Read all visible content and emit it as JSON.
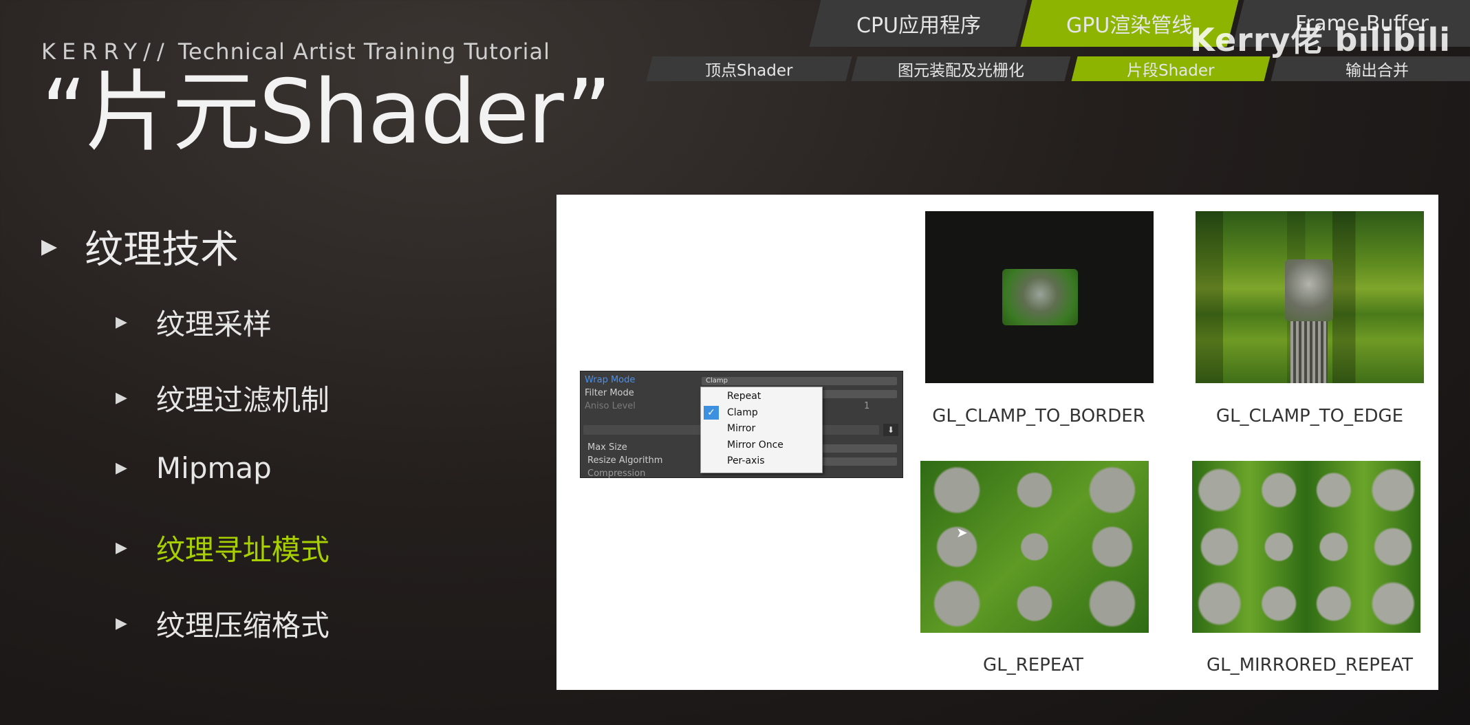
{
  "header": {
    "subtitle_brand": "KERRY//",
    "subtitle_rest": "Technical Artist Training Tutorial",
    "title": "“片元Shader”"
  },
  "top_tabs": [
    "CPU应用程序",
    "GPU渲染管线",
    "Frame Buffer"
  ],
  "sub_tabs": [
    "顶点Shader",
    "图元装配及光栅化",
    "片段Shader",
    "输出合并"
  ],
  "watermark": "Kerry佬 bilibili",
  "bullets": {
    "main": "纹理技术",
    "items": [
      "纹理采样",
      "纹理过滤机制",
      "Mipmap",
      "纹理寻址模式",
      "纹理压缩格式"
    ]
  },
  "inspector": {
    "rows": [
      "Wrap Mode",
      "Filter Mode",
      "Aniso Level",
      "Max Size",
      "Resize Algorithm",
      "Compression"
    ],
    "wrap_value": "Clamp",
    "aniso_value": "1",
    "options": [
      "Repeat",
      "Clamp",
      "Mirror",
      "Mirror Once",
      "Per-axis"
    ],
    "selected": "Clamp"
  },
  "examples": [
    {
      "label": "GL_CLAMP_TO_BORDER"
    },
    {
      "label": "GL_CLAMP_TO_EDGE"
    },
    {
      "label": "GL_REPEAT"
    },
    {
      "label": "GL_MIRRORED_REPEAT"
    }
  ],
  "colors": {
    "accent_green": "#8cb400",
    "active_text": "#a8d000",
    "tab_dark": "#3a3a3a"
  }
}
